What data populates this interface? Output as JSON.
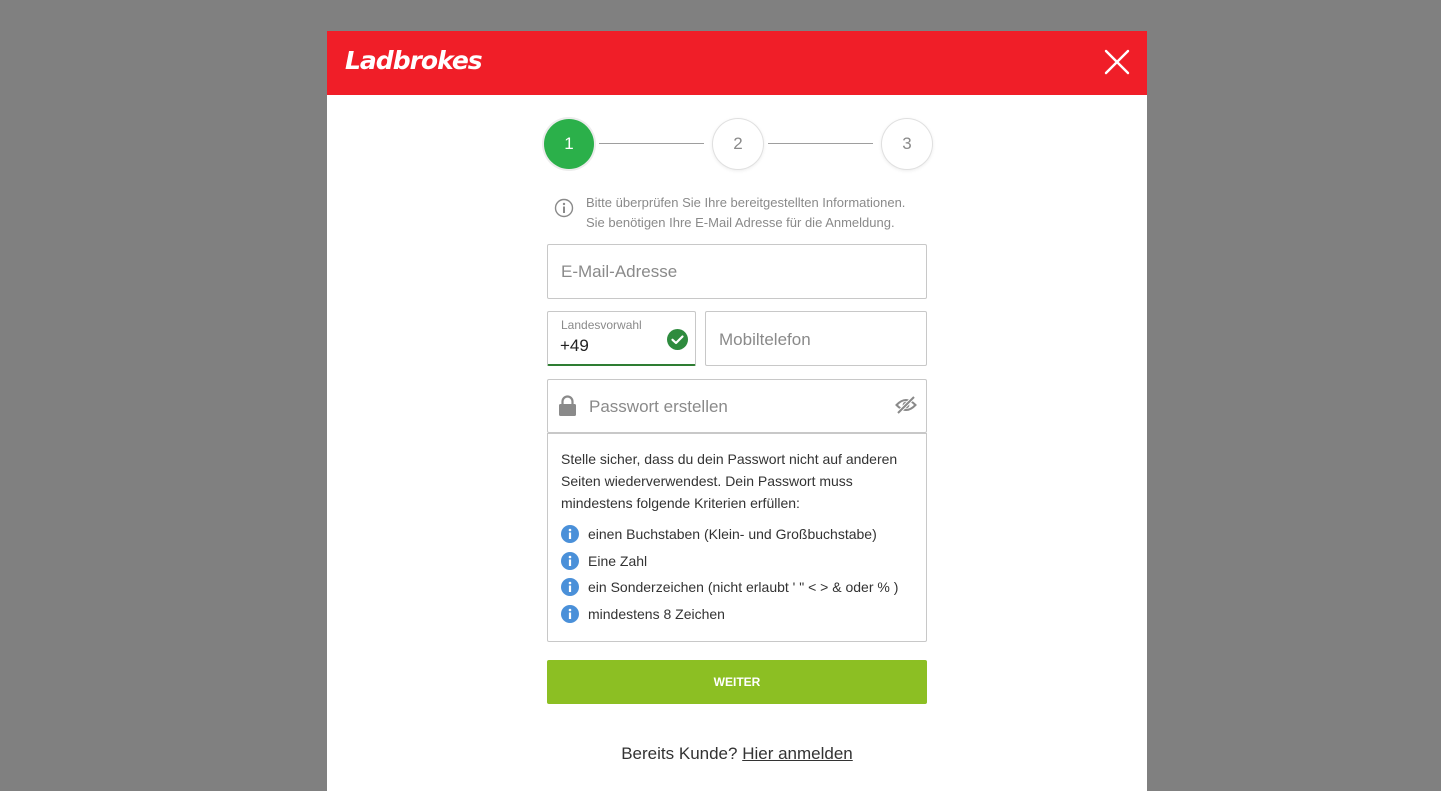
{
  "header": {
    "logo_text": "Ladbrokes",
    "close_icon": "close-icon",
    "brand_color": "#f01e28"
  },
  "steps": [
    {
      "number": "1",
      "state": "active"
    },
    {
      "number": "2",
      "state": "inactive"
    },
    {
      "number": "3",
      "state": "inactive"
    }
  ],
  "info_note": {
    "icon": "info-icon",
    "text": "Bitte überprüfen Sie Ihre bereitgestellten Informationen. Sie benötigen Ihre E-Mail Adresse für die Anmeldung."
  },
  "form": {
    "email": {
      "placeholder": "E-Mail-Adresse",
      "value": ""
    },
    "country_code": {
      "label": "Landesvorwahl",
      "value": "+49",
      "status_icon": "check-circle-icon"
    },
    "mobile": {
      "placeholder": "Mobiltelefon",
      "value": ""
    },
    "password": {
      "placeholder": "Passwort erstellen",
      "value": "",
      "lock_icon": "lock-icon",
      "toggle_icon": "eye-off-icon"
    }
  },
  "password_rules": {
    "intro": "Stelle sicher, dass du dein Passwort nicht auf anderen Seiten wiederverwendest. Dein Passwort muss mindestens folgende Kriterien erfüllen:",
    "items": [
      "einen Buchstaben (Klein- und Großbuchstabe)",
      "Eine Zahl",
      "ein Sonderzeichen (nicht erlaubt ' \" < > & oder % )",
      "mindestens 8 Zeichen"
    ]
  },
  "submit": {
    "label": "WEITER",
    "color": "#8cbf23"
  },
  "footer": {
    "prompt": "Bereits Kunde?",
    "link": "Hier anmelden"
  }
}
